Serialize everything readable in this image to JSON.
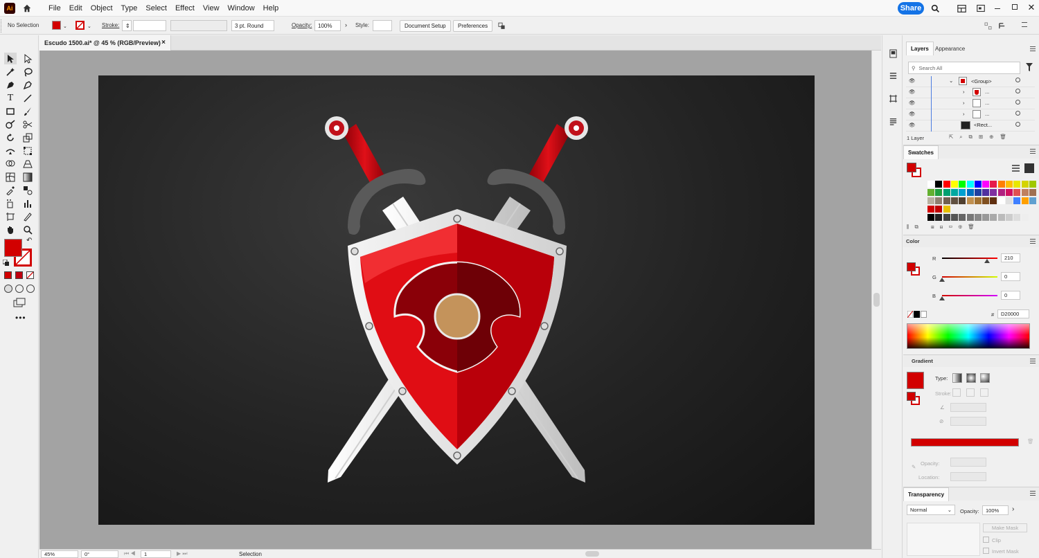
{
  "app": {
    "logo_text": "Ai"
  },
  "menu": [
    "File",
    "Edit",
    "Object",
    "Type",
    "Select",
    "Effect",
    "View",
    "Window",
    "Help"
  ],
  "share_label": "Share",
  "control": {
    "selection": "No Selection",
    "stroke_label": "Stroke:",
    "brush": "3 pt. Round",
    "opacity_label": "Opacity:",
    "opacity_value": "100%",
    "style_label": "Style:",
    "doc_setup": "Document Setup",
    "preferences": "Preferences"
  },
  "document": {
    "tab_title": "Escudo 1500.ai* @ 45 % (RGB/Preview)",
    "close": "×"
  },
  "status": {
    "zoom": "45%",
    "rotation": "0°",
    "artboard": "1",
    "tool": "Selection"
  },
  "colors": {
    "fill": "#d20000",
    "shield_red": "#e00d14",
    "shield_dark": "#8a0008",
    "boss": "#c4935b",
    "artboard_bg": "#1e1e1e",
    "accent": "#1473e6"
  },
  "layers_panel": {
    "tabs": [
      "Layers",
      "Appearance"
    ],
    "search_placeholder": "Search All",
    "rows": [
      {
        "name": "<Group>"
      },
      {
        "name": "..."
      },
      {
        "name": "..."
      },
      {
        "name": "..."
      },
      {
        "name": "<Rect..."
      }
    ],
    "count": "1 Layer"
  },
  "swatches_panel": {
    "title": "Swatches"
  },
  "color_panel": {
    "title": "Color",
    "r_label": "R",
    "r_value": "210",
    "g_label": "G",
    "g_value": "0",
    "b_label": "B",
    "b_value": "0",
    "hex_label": "#",
    "hex_value": "D20000"
  },
  "gradient_panel": {
    "title": "Gradient",
    "type_label": "Type:",
    "stroke_label": "Stroke:",
    "opacity_label": "Opacity:",
    "location_label": "Location:"
  },
  "transparency_panel": {
    "title": "Transparency",
    "blend_mode": "Normal",
    "opacity_label": "Opacity:",
    "opacity_value": "100%",
    "make_mask": "Make Mask",
    "clip": "Clip",
    "invert_mask": "Invert Mask"
  }
}
